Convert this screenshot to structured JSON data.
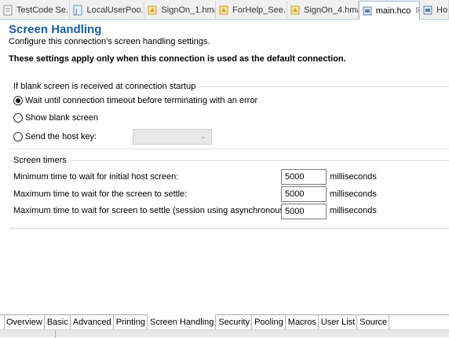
{
  "editor_tabs": [
    {
      "label": "TestCode Se...",
      "icon": "test-file-icon",
      "color": "#8a8a8a"
    },
    {
      "label": "LocalUserPoo...",
      "icon": "java-file-icon",
      "color": "#6b8fbf"
    },
    {
      "label": "SignOn_1.hma",
      "icon": "macro-file-icon",
      "color": "#c8a02a"
    },
    {
      "label": "ForHelp_See...",
      "icon": "macro-file-icon",
      "color": "#c8a02a"
    },
    {
      "label": "SignOn_4.hma",
      "icon": "macro-file-icon",
      "color": "#c8a02a"
    },
    {
      "label": "main.hco",
      "icon": "connection-file-icon",
      "color": "#5d7fa8",
      "active": true,
      "close": "☒"
    },
    {
      "label": "Ho",
      "icon": "connection-file-icon",
      "color": "#5d7fa8"
    }
  ],
  "header": {
    "title": "Screen Handling",
    "subtitle": "Configure this connection's screen handling settings.",
    "notice": "These settings apply only when this connection is used as the default connection."
  },
  "blank_screen": {
    "title": "If blank screen is received at connection startup",
    "options": [
      {
        "label": "Wait until connection timeout before terminating with an error",
        "checked": true
      },
      {
        "label": "Show blank screen",
        "checked": false
      },
      {
        "label": "Send the host key:",
        "checked": false
      }
    ],
    "host_key_value": ""
  },
  "timers": {
    "title": "Screen timers",
    "rows": [
      {
        "label": "Minimum time to wait for initial host screen:",
        "value": "5000",
        "unit": "milliseconds"
      },
      {
        "label": "Maximum time to wait for the screen to settle:",
        "value": "5000",
        "unit": "milliseconds"
      },
      {
        "label": "Maximum time to wait for screen to settle (session using asynchronous update):",
        "value": "5000",
        "unit": "milliseconds"
      }
    ]
  },
  "bottom_tabs": [
    {
      "label": "Overview"
    },
    {
      "label": "Basic"
    },
    {
      "label": "Advanced"
    },
    {
      "label": "Printing"
    },
    {
      "label": "Screen Handling",
      "active": true
    },
    {
      "label": "Security"
    },
    {
      "label": "Pooling"
    },
    {
      "label": "Macros"
    },
    {
      "label": "User List"
    },
    {
      "label": "Source"
    }
  ],
  "colors": {
    "title": "#1b5a9e",
    "tab_border": "#a9b9cf"
  }
}
